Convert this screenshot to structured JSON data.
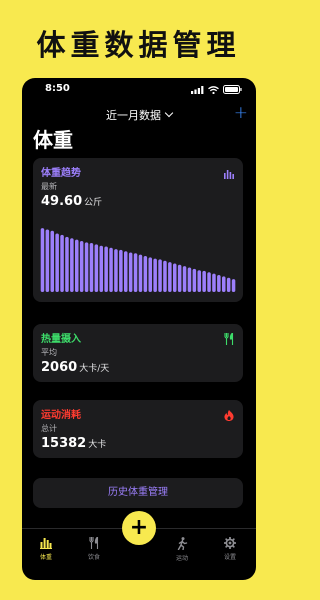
{
  "banner_title": "体重数据管理",
  "status_bar": {
    "time": "8:50"
  },
  "nav": {
    "title": "近一月数据",
    "add_label": "+"
  },
  "page_title": "体重",
  "weight_card": {
    "title": "体重趋势",
    "subtitle": "最新",
    "value": "49.60",
    "unit": "公斤",
    "accent": "#9c7ffb",
    "trend_levels": [
      0.94,
      0.92,
      0.9,
      0.86,
      0.84,
      0.81,
      0.79,
      0.77,
      0.75,
      0.73,
      0.72,
      0.7,
      0.68,
      0.67,
      0.65,
      0.63,
      0.62,
      0.6,
      0.58,
      0.57,
      0.55,
      0.53,
      0.51,
      0.49,
      0.48,
      0.46,
      0.44,
      0.42,
      0.4,
      0.38,
      0.36,
      0.34,
      0.32,
      0.31,
      0.29,
      0.27,
      0.25,
      0.23,
      0.21,
      0.19
    ]
  },
  "intake_card": {
    "title": "热量摄入",
    "subtitle": "平均",
    "value": "2060",
    "unit": "大卡/天",
    "accent": "#3ddc6a",
    "icon": "fork-knife-icon"
  },
  "burn_card": {
    "title": "运动消耗",
    "subtitle": "总计",
    "value": "15382",
    "unit": "大卡",
    "accent": "#ff3b30",
    "icon": "flame-icon"
  },
  "history_button": "历史体重管理",
  "tabs": [
    {
      "label": "体重",
      "icon": "chart-icon",
      "active": true
    },
    {
      "label": "饮食",
      "icon": "fork-knife-icon",
      "active": false
    },
    {
      "label": "运动",
      "icon": "runner-icon",
      "active": false
    },
    {
      "label": "设置",
      "icon": "gear-icon",
      "active": false
    }
  ],
  "fab_label": "+"
}
